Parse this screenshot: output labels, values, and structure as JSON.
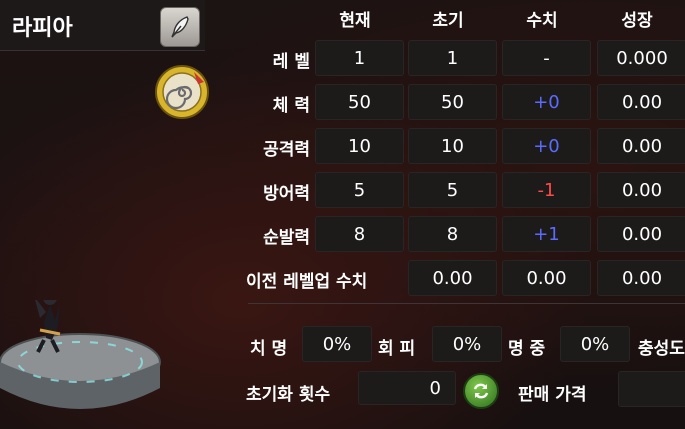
{
  "character": {
    "name": "라피아"
  },
  "columns": [
    "현재",
    "초기",
    "수치",
    "성장"
  ],
  "stats": [
    {
      "label": "레 벨",
      "current": "1",
      "initial": "1",
      "delta": "-",
      "delta_color": "#ffffff",
      "growth": "0.000"
    },
    {
      "label": "체 력",
      "current": "50",
      "initial": "50",
      "delta": "+0",
      "delta_color": "#5a6cff",
      "growth": "0.00"
    },
    {
      "label": "공격력",
      "current": "10",
      "initial": "10",
      "delta": "+0",
      "delta_color": "#5a6cff",
      "growth": "0.00"
    },
    {
      "label": "방어력",
      "current": "5",
      "initial": "5",
      "delta": "-1",
      "delta_color": "#ff4a4a",
      "growth": "0.00"
    },
    {
      "label": "순발력",
      "current": "8",
      "initial": "8",
      "delta": "+1",
      "delta_color": "#5a6cff",
      "growth": "0.00"
    }
  ],
  "prev_levelup": {
    "label": "이전 레벨업 수치",
    "values": [
      "0.00",
      "0.00",
      "0.00"
    ]
  },
  "secondary": [
    {
      "label": "치 명",
      "value": "0%"
    },
    {
      "label": "회 피",
      "value": "0%"
    },
    {
      "label": "명 중",
      "value": "0%"
    },
    {
      "label": "충성도",
      "value": ""
    }
  ],
  "reset": {
    "label": "초기화 횟수",
    "value": "0"
  },
  "sale": {
    "label": "판매 가격",
    "value": ""
  },
  "icons": {
    "edit": "quill-edit-icon",
    "element": "wind-element-icon",
    "reset": "refresh-icon"
  }
}
